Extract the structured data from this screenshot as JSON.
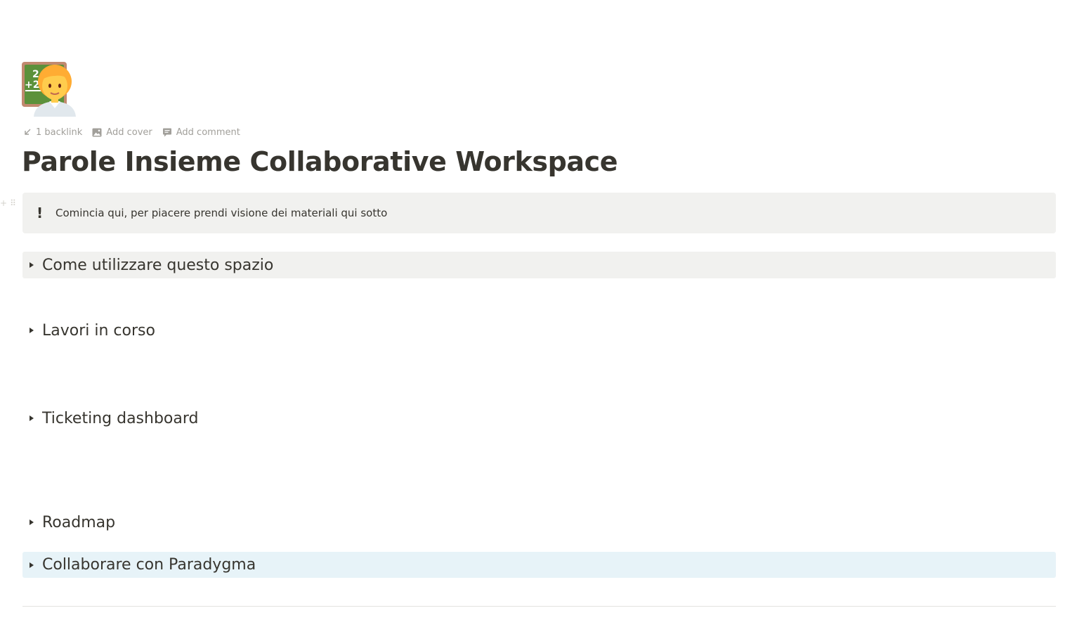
{
  "page": {
    "title": "Parole Insieme Collaborative Workspace",
    "icon": "teacher-emoji-icon"
  },
  "meta": {
    "backlinks_label": "1 backlink",
    "add_cover_label": "Add cover",
    "add_comment_label": "Add comment"
  },
  "callout": {
    "icon": "!",
    "text": "Comincia qui, per piacere prendi visione dei materiali qui sotto",
    "background": "#f1f1ef"
  },
  "toggles": [
    {
      "label": "Come utilizzare questo spazio",
      "background": "#f1f1ef"
    },
    {
      "label": "Lavori in corso",
      "background": "none"
    },
    {
      "label": "Ticketing dashboard",
      "background": "none"
    },
    {
      "label": "Roadmap",
      "background": "none"
    },
    {
      "label": "Collaborare con Paradygma",
      "background": "#e7f3f8"
    }
  ],
  "colors": {
    "text": "#37352f",
    "muted": "#a19f9a",
    "gray_block": "#f1f1ef",
    "blue_block": "#e7f3f8"
  }
}
